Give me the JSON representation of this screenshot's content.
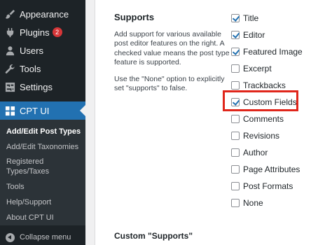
{
  "sidebar": {
    "items": [
      {
        "label": "Appearance",
        "icon": "paintbrush-icon"
      },
      {
        "label": "Plugins",
        "icon": "plug-icon",
        "badge": "2"
      },
      {
        "label": "Users",
        "icon": "user-icon"
      },
      {
        "label": "Tools",
        "icon": "wrench-icon"
      },
      {
        "label": "Settings",
        "icon": "settings-icon"
      }
    ],
    "active": {
      "label": "CPT UI",
      "icon": "grid-icon"
    },
    "submenu": [
      "Add/Edit Post Types",
      "Add/Edit Taxonomies",
      "Registered Types/Taxes",
      "Tools",
      "Help/Support",
      "About CPT UI"
    ],
    "collapse_label": "Collapse menu"
  },
  "supports": {
    "title": "Supports",
    "description": "Add support for various available post editor features on the right. A checked value means the post type feature is supported.",
    "note": "Use the \"None\" option to explicitly set \"supports\" to false.",
    "options": [
      {
        "label": "Title",
        "checked": true
      },
      {
        "label": "Editor",
        "checked": true
      },
      {
        "label": "Featured Image",
        "checked": true
      },
      {
        "label": "Excerpt",
        "checked": false
      },
      {
        "label": "Trackbacks",
        "checked": false
      },
      {
        "label": "Custom Fields",
        "checked": true
      },
      {
        "label": "Comments",
        "checked": false
      },
      {
        "label": "Revisions",
        "checked": false
      },
      {
        "label": "Author",
        "checked": false
      },
      {
        "label": "Page Attributes",
        "checked": false
      },
      {
        "label": "Post Formats",
        "checked": false
      },
      {
        "label": "None",
        "checked": false
      }
    ],
    "highlight_color": "#e0261b"
  },
  "custom_supports": {
    "title": "Custom \"Supports\""
  },
  "colors": {
    "sidebar_bg": "#1d2327",
    "active_bg": "#2271b1",
    "badge": "#d63638"
  }
}
